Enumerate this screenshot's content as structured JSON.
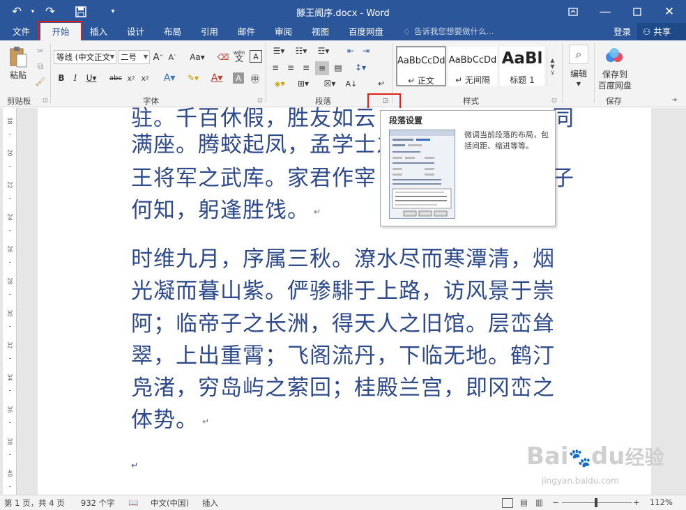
{
  "titlebar": {
    "title": "滕王阁序.docx - Word"
  },
  "menu": {
    "tabs": [
      "文件",
      "开始",
      "插入",
      "设计",
      "布局",
      "引用",
      "邮件",
      "审阅",
      "视图",
      "百度网盘"
    ],
    "tell_me": "告诉我您想要做什么...",
    "login": "登录",
    "share": "共享"
  },
  "ribbon": {
    "clipboard": {
      "paste": "粘贴",
      "label": "剪贴板"
    },
    "font": {
      "font_name": "等线 (中文正文",
      "font_size": "二号",
      "label": "字体",
      "wen": "wén",
      "wen_char": "文"
    },
    "paragraph": {
      "label": "段落"
    },
    "styles": {
      "label": "样式",
      "items": [
        {
          "sample": "AaBbCcDd",
          "name": "↵ 正文"
        },
        {
          "sample": "AaBbCcDd",
          "name": "↵ 无间隔"
        },
        {
          "sample": "AaBl",
          "name": "标题 1"
        }
      ]
    },
    "editing": {
      "label": "编辑"
    },
    "save": {
      "label_line1": "保存到",
      "label_line2": "百度网盘",
      "group": "保存"
    }
  },
  "tooltip": {
    "title": "段落设置",
    "description": "微调当前段落的布局，包括间距、缩进等等。"
  },
  "document": {
    "lines": [
      "驻。千百休假，胜友如云",
      "满座。腾蛟起凤，孟学士之",
      "王将军之武库。家君作宰",
      "何知，躬逢胜饯。",
      "时维九月，序属三秋。潦水尽而寒潭清，烟",
      "光凝而暮山紫。俨骖騑于上路，访风景于崇",
      "阿；临帝子之长洲，得天人之旧馆。层峦耸",
      "翠，上出重霄；飞阁流丹，下临无地。鹤汀",
      "凫渚，穷岛屿之萦回；桂殿兰宫，即冈峦之",
      "体势。"
    ],
    "right_fragments": {
      "line1": "同",
      "line3": "子"
    }
  },
  "ruler": {
    "numbers": [
      "18",
      "20",
      "22",
      "24",
      "26",
      "28",
      "30",
      "32",
      "34",
      "36",
      "38",
      "40"
    ]
  },
  "watermark": {
    "brand": "Bai",
    "brand2": "du",
    "jingyan": "经验",
    "url": "jingyan.baidu.com"
  },
  "statusbar": {
    "page": "第 1 页，共 4 页",
    "words": "932 个字",
    "language": "中文(中国)",
    "mode": "插入",
    "zoom": "112%"
  },
  "colors": {
    "accent": "#2b579a",
    "highlight": "#e0201b",
    "text": "#2e4a8a"
  }
}
